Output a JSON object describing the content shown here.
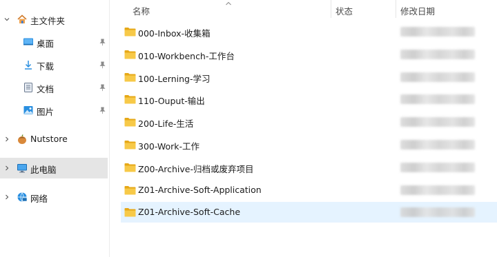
{
  "nav": {
    "home": {
      "label": "主文件夹",
      "icon": "home-icon",
      "expanded": true
    },
    "quick_access": [
      {
        "label": "桌面",
        "icon": "desktop-icon",
        "pinned": true
      },
      {
        "label": "下载",
        "icon": "download-icon",
        "pinned": true
      },
      {
        "label": "文档",
        "icon": "document-icon",
        "pinned": true
      },
      {
        "label": "图片",
        "icon": "picture-icon",
        "pinned": true
      }
    ],
    "nutstore": {
      "label": "Nutstore",
      "icon": "nutstore-icon",
      "expanded": false
    },
    "this_pc": {
      "label": "此电脑",
      "icon": "computer-icon",
      "expanded": false,
      "selected": true
    },
    "network": {
      "label": "网络",
      "icon": "network-icon",
      "expanded": false
    }
  },
  "columns": {
    "name": "名称",
    "status": "状态",
    "modified": "修改日期"
  },
  "files": [
    {
      "name": "000-Inbox-收集箱",
      "type": "folder",
      "selected": false
    },
    {
      "name": "010-Workbench-工作台",
      "type": "folder",
      "selected": false
    },
    {
      "name": "100-Lerning-学习",
      "type": "folder",
      "selected": false
    },
    {
      "name": "110-Ouput-输出",
      "type": "folder",
      "selected": false
    },
    {
      "name": "200-Life-生活",
      "type": "folder",
      "selected": false
    },
    {
      "name": "300-Work-工作",
      "type": "folder",
      "selected": false
    },
    {
      "name": "Z00-Archive-归档或废弃项目",
      "type": "folder",
      "selected": false
    },
    {
      "name": "Z01-Archive-Soft-Application",
      "type": "folder",
      "selected": false
    },
    {
      "name": "Z01-Archive-Soft-Cache",
      "type": "folder",
      "selected": true
    }
  ],
  "colors": {
    "folder": "#f7c948",
    "folder_dark": "#e6a817",
    "selected_row": "#e5f3ff",
    "selected_nav": "#e5e5e5"
  }
}
